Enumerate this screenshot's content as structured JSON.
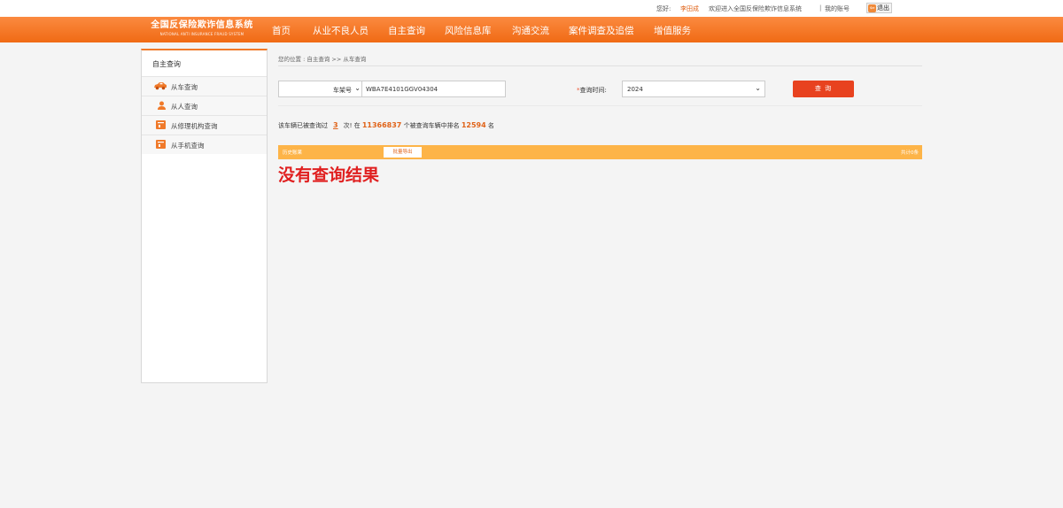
{
  "topbar": {
    "greeting": "您好:",
    "username": "李田成",
    "welcome": "欢迎进入全国反保险欺诈信息系统",
    "separator": "|",
    "my_account": "我的账号",
    "logout": "退出"
  },
  "logo": {
    "title": "全国反保险欺诈信息系统",
    "subtitle": "NATIONAL ANTI INSURANCE FRAUD SYSTEM"
  },
  "nav": {
    "items": [
      {
        "label": "首页"
      },
      {
        "label": "从业不良人员"
      },
      {
        "label": "自主查询"
      },
      {
        "label": "风险信息库"
      },
      {
        "label": "沟通交流"
      },
      {
        "label": "案件调查及追偿"
      },
      {
        "label": "增值服务"
      }
    ]
  },
  "sidebar": {
    "title": "自主查询",
    "items": [
      {
        "label": "从车查询",
        "icon": "car-icon"
      },
      {
        "label": "从人查询",
        "icon": "person-icon"
      },
      {
        "label": "从修理机构查询",
        "icon": "repair-shop-icon"
      },
      {
        "label": "从手机查询",
        "icon": "phone-icon"
      }
    ]
  },
  "main": {
    "breadcrumb": "您的位置 : 自主查询 >> 从车查询",
    "query_type": "车架号",
    "vin_value": "WBA7E4101GGV04304",
    "time_required_mark": "*",
    "time_label": "查询时间:",
    "year_value": "2024",
    "query_button": "查 询",
    "stats": {
      "prefix": "该车辆已被查询过",
      "count": "3",
      "mid1": "次! 在",
      "total": "11366837",
      "mid2": "个被查询车辆中排名",
      "rank": "12594",
      "suffix": "名"
    },
    "result_bar": {
      "title": "历史账果",
      "export_button": "批量导出",
      "total": "共计0条"
    },
    "no_result": "没有查询结果"
  },
  "colors": {
    "brand_orange": "#f06a14",
    "query_button": "#e8421f",
    "result_bar": "#fdb448",
    "no_result_text": "#e02020"
  }
}
